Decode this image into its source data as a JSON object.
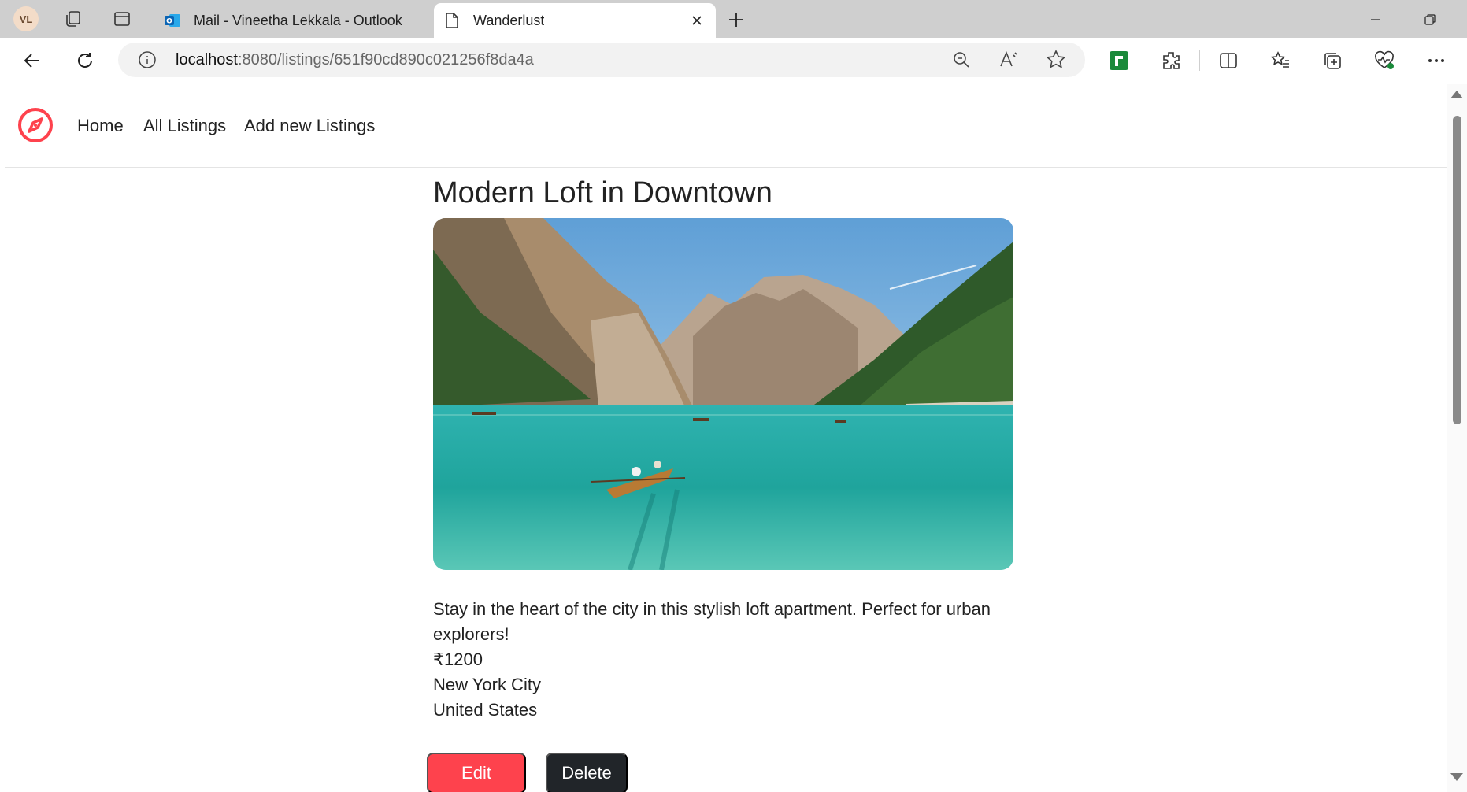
{
  "browser": {
    "profile_initials": "VL",
    "tabs": [
      {
        "title": "Mail - Vineetha Lekkala - Outlook",
        "icon": "outlook-icon"
      },
      {
        "title": "Wanderlust",
        "icon": "document-icon"
      }
    ],
    "url_host": "localhost",
    "url_rest": ":8080/listings/651f90cd890c021256f8da4a"
  },
  "site": {
    "nav": {
      "home": "Home",
      "all_listings": "All Listings",
      "add_new": "Add new Listings"
    },
    "brand_icon": "compass-icon",
    "accent_color": "#fe424d"
  },
  "listing": {
    "title": "Modern Loft in Downtown",
    "description": "Stay in the heart of the city in this stylish loft apartment. Perfect for urban explorers!",
    "price": "₹1200",
    "location": "New York City",
    "country": "United States",
    "image_alt": "mountain lake with rowboat"
  },
  "actions": {
    "edit": "Edit",
    "delete": "Delete"
  }
}
